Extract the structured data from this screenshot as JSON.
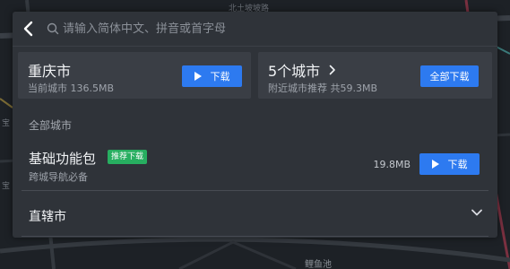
{
  "search": {
    "placeholder": "请输入简体中文、拼音或首字母"
  },
  "current_city": {
    "name": "重庆市",
    "subtitle_label": "当前城市",
    "size": "136.5MB",
    "download_label": "下载"
  },
  "nearby": {
    "title": "5个城市",
    "subtitle": "附近城市推荐",
    "total": "共59.3MB",
    "download_all_label": "全部下载"
  },
  "all_cities": {
    "section_label": "全部城市",
    "base_package": {
      "title": "基础功能包",
      "badge": "推荐下载",
      "subtitle": "跨城导航必备",
      "size": "19.8MB",
      "download_label": "下载"
    },
    "municipalities": {
      "label": "直辖市"
    }
  },
  "map_background": {
    "visible_text": [
      "北土坡坡路",
      "宝",
      "宝",
      "鲤鱼池"
    ]
  },
  "colors": {
    "accent_blue": "#2d7af0",
    "badge_green": "#27ae60",
    "panel_bg": "#2f3339",
    "card_bg": "#3a3e45"
  }
}
